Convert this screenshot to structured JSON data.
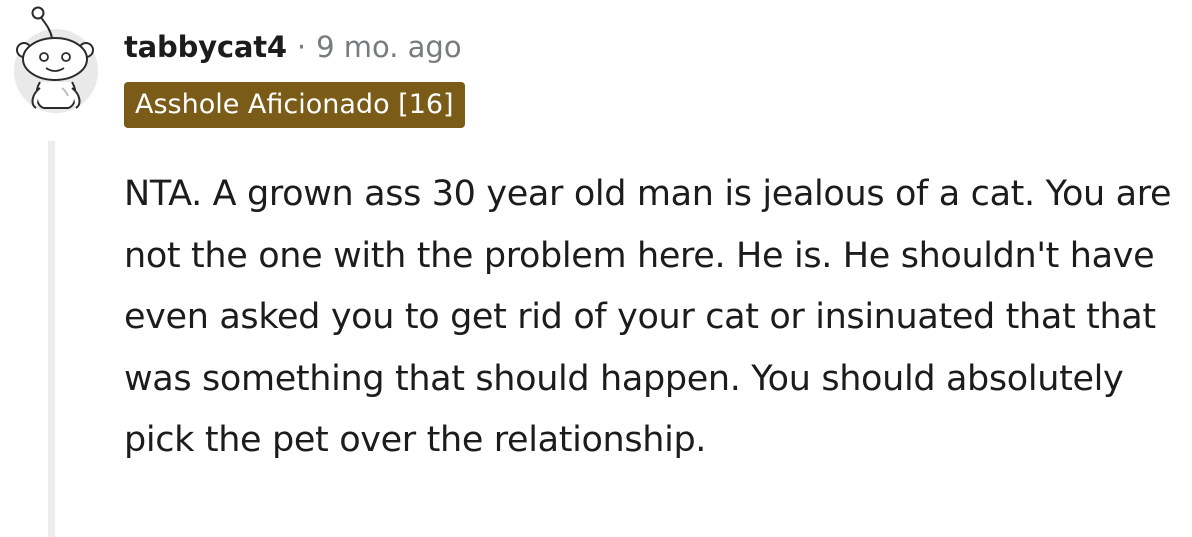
{
  "comment": {
    "username": "tabbycat4",
    "separator": "·",
    "timestamp": "9 mo. ago",
    "flair": "Asshole Aficionado [16]",
    "body": "NTA. A grown ass 30 year old man is jealous of a cat. You are not the one with the problem here. He is. He shouldn't have even asked you to get rid of your cat or insinuated that that was something that should happen. You should absolutely pick the pet over the relationship."
  },
  "colors": {
    "flair_background": "#7a5b17",
    "flair_text": "#ffffff",
    "meta_text": "#787c7e",
    "thread_line": "#ededed"
  },
  "icons": {
    "avatar": "reddit-snoo-avatar-icon"
  }
}
